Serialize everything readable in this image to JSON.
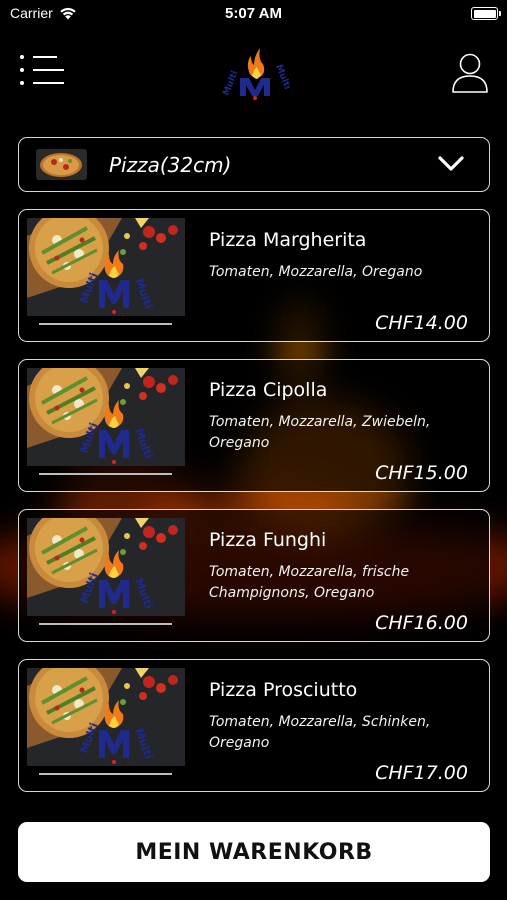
{
  "status_bar": {
    "carrier": "Carrier",
    "time": "5:07 AM"
  },
  "header": {
    "menu_icon": "menu-icon",
    "logo_icon": "multi-m-flame-logo",
    "user_icon": "user-icon"
  },
  "category": {
    "selected": "Pizza(32cm)",
    "dropdown_icon": "chevron-down-icon"
  },
  "products": [
    {
      "name": "Pizza Margherita",
      "description": "Tomaten, Mozzarella, Oregano",
      "price": "CHF14.00"
    },
    {
      "name": "Pizza Cipolla",
      "description": "Tomaten, Mozzarella, Zwiebeln, Oregano",
      "price": "CHF15.00"
    },
    {
      "name": "Pizza Funghi",
      "description": "Tomaten, Mozzarella, frische Champignons, Oregano",
      "price": "CHF16.00"
    },
    {
      "name": "Pizza Prosciutto",
      "description": "Tomaten, Mozzarella, Schinken, Oregano",
      "price": "CHF17.00"
    }
  ],
  "cart": {
    "label": "MEIN WARENKORB"
  },
  "colors": {
    "background": "#000000",
    "card_border": "#d8d8d8",
    "button_background": "#ffffff",
    "logo_blue": "#1f2a8c",
    "logo_flame": "#f07a1a"
  }
}
